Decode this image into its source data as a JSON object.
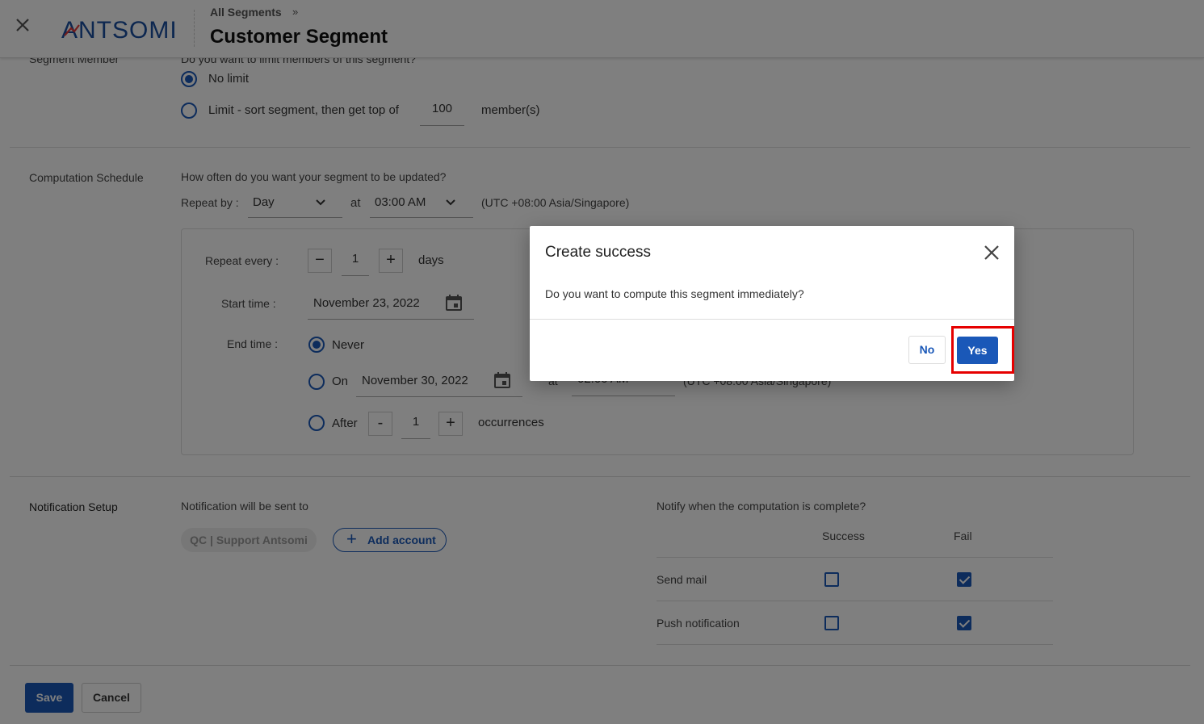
{
  "header": {
    "logo": "ANTSOMI",
    "breadcrumb": "All Segments",
    "breadcrumb_sep": "»",
    "title": "Customer Segment"
  },
  "segment_member": {
    "label": "Segment Member",
    "question": "Do you want to limit members of this segment?",
    "option_no_limit": "No limit",
    "option_limit": "Limit - sort segment, then get top of",
    "limit_value": "100",
    "limit_unit": "member(s)",
    "selected": "no_limit"
  },
  "schedule": {
    "label": "Computation Schedule",
    "question": "How often do you want your segment to be updated?",
    "repeat_by_label": "Repeat by :",
    "repeat_by_value": "Day",
    "at_label": "at",
    "time_value": "03:00 AM",
    "timezone": "(UTC +08:00 Asia/Singapore)",
    "repeat_every_label": "Repeat every :",
    "repeat_every_value": "1",
    "repeat_every_unit": "days",
    "start_time_label": "Start time :",
    "start_time_value": "November 23, 2022",
    "end_time_label": "End time :",
    "end_never": "Never",
    "end_on": "On",
    "end_on_date": "November 30, 2022",
    "end_on_at": "at",
    "end_on_time": "02:00 AM",
    "end_on_timezone": "(UTC +08:00 Asia/Singapore)",
    "end_after": "After",
    "occurrences_value": "1",
    "occurrences_unit": "occurrences",
    "end_selected": "never"
  },
  "notification": {
    "label": "Notification Setup",
    "sent_to_label": "Notification will be sent to",
    "account_chip": "QC | Support Antsomi",
    "add_account": "Add account",
    "notify_question": "Notify when the computation is complete?",
    "col_success": "Success",
    "col_fail": "Fail",
    "rows": [
      {
        "label": "Send mail",
        "success": false,
        "fail": true
      },
      {
        "label": "Push notification",
        "success": false,
        "fail": true
      }
    ]
  },
  "footer": {
    "save": "Save",
    "cancel": "Cancel"
  },
  "dialog": {
    "title": "Create success",
    "message": "Do you want to compute this segment immediately?",
    "no": "No",
    "yes": "Yes"
  },
  "colors": {
    "primary": "#1a58b8",
    "highlight": "#e60000"
  }
}
